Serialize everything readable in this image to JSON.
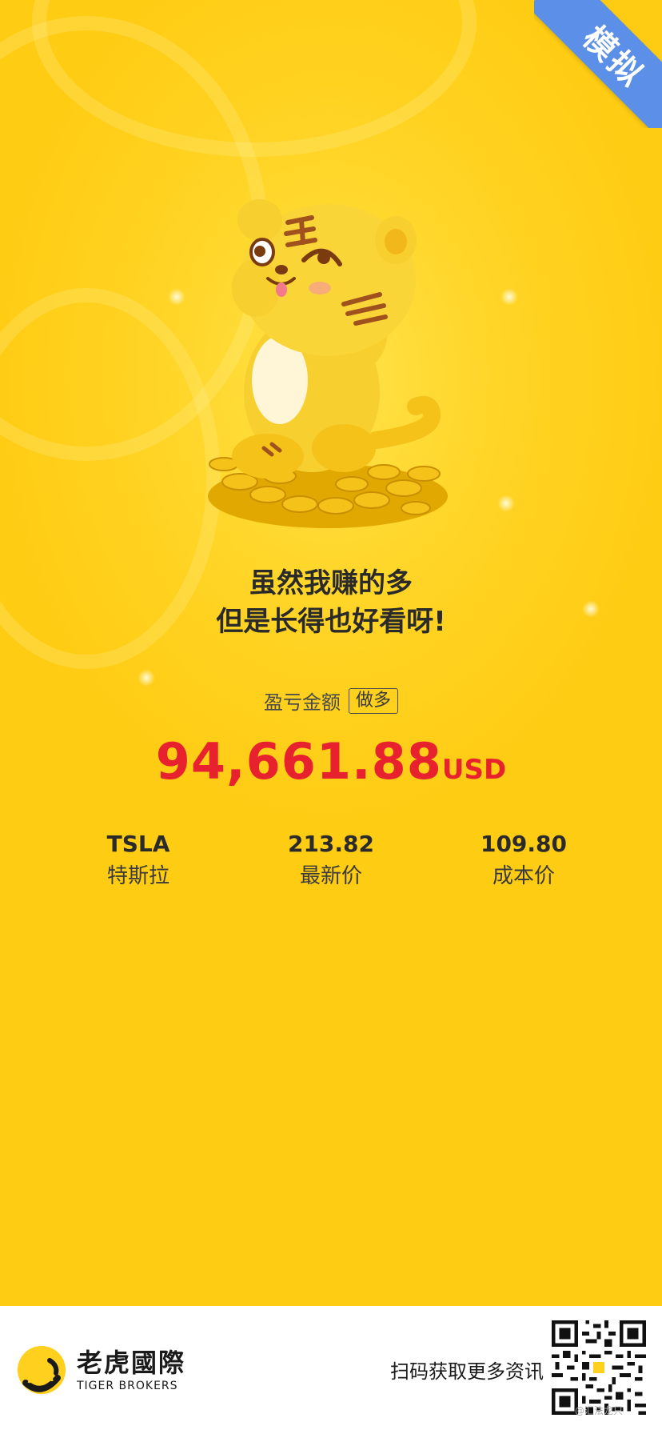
{
  "badge": {
    "label": "模拟"
  },
  "headline": {
    "line1": "虽然我赚的多",
    "line2": "但是长得也好看呀!"
  },
  "pnl": {
    "label": "盈亏金额",
    "direction": "做多",
    "amount": "94,661.88",
    "currency": "USD"
  },
  "stats": [
    {
      "value": "TSLA",
      "label": "特斯拉"
    },
    {
      "value": "213.82",
      "label": "最新价"
    },
    {
      "value": "109.80",
      "label": "成本价"
    }
  ],
  "footer": {
    "brand_cn": "老虎國際",
    "brand_en": "TIGER BROKERS",
    "scan_text": "扫码获取更多资讯",
    "watermark": "@汇法龙只"
  },
  "colors": {
    "background": "#FFD11E",
    "amount": "#E8212E",
    "badge": "#5B8FE8"
  },
  "icons": {
    "mascot": "tiger-mascot-on-coins",
    "logo": "tiger-logo-icon",
    "qr": "qr-code"
  }
}
